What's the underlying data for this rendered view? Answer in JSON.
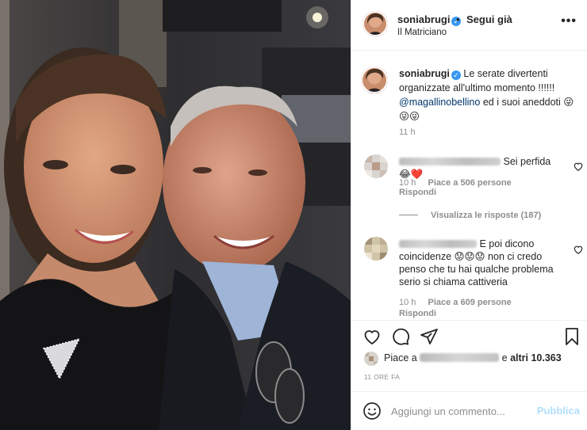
{
  "post": {
    "username": "soniabrugi",
    "separator": "•",
    "follow_label": "Segui già",
    "location": "Il Matriciano",
    "more_icon": "more-horizontal-icon"
  },
  "caption": {
    "username": "soniabrugi",
    "text_1": " Le serate divertenti organizzate all'ultimo momento !!!!!! ",
    "mention": "@magallinobellino",
    "text_2": " ed i suoi aneddoti 😜😜😜",
    "time": "11 h"
  },
  "comments": [
    {
      "text": "Sei perfida 😂❤️",
      "time": "10 h",
      "likes_label": "Piace a 506 persone",
      "reply_label": "Rispondi",
      "view_replies": "Visualizza le risposte (187)"
    },
    {
      "text": "E poi dicono coincidenze 😟😟😟 non ci credo penso che tu hai qualche problema serio si chiama cattiveria",
      "time": "10 h",
      "likes_label": "Piace a 609 persone",
      "reply_label": "Rispondi"
    }
  ],
  "likes": {
    "prefix": "Piace a ",
    "suffix": " e ",
    "others": "altri 10.363"
  },
  "post_time": "11 ORE FA",
  "composer": {
    "placeholder": "Aggiungi un commento...",
    "publish_label": "Pubblica"
  },
  "colors": {
    "accent": "#3897f0",
    "publish_disabled": "#b2dffc",
    "secondary_text": "#8e8e8e",
    "mention": "#00376b"
  }
}
